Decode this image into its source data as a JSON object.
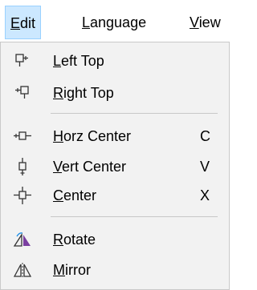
{
  "menubar": {
    "items": [
      {
        "mnemonic": "E",
        "rest": "dit"
      },
      {
        "mnemonic": "L",
        "rest": "anguage"
      },
      {
        "mnemonic": "V",
        "rest": "iew"
      }
    ]
  },
  "menu": {
    "items": [
      {
        "mnemonic": "L",
        "rest": "eft Top",
        "shortcut": "",
        "icon": "align-left-top-icon"
      },
      {
        "mnemonic": "R",
        "rest": "ight Top",
        "shortcut": "",
        "icon": "align-right-top-icon"
      },
      {
        "mnemonic": "H",
        "rest": "orz Center",
        "shortcut": "C",
        "icon": "horizontal-center-icon"
      },
      {
        "mnemonic": "V",
        "rest": "ert Center",
        "shortcut": "V",
        "icon": "vertical-center-icon"
      },
      {
        "mnemonic": "C",
        "rest": "enter",
        "shortcut": "X",
        "icon": "center-icon"
      },
      {
        "mnemonic": "R",
        "rest": "otate",
        "shortcut": "",
        "icon": "rotate-icon"
      },
      {
        "mnemonic": "M",
        "rest": "irror",
        "shortcut": "",
        "icon": "mirror-icon"
      }
    ]
  },
  "colors": {
    "menubar_active_bg": "#cce8ff",
    "menu_bg": "#f2f2f2",
    "icon_purple": "#7a3fa0",
    "accent_blue": "#1e8fe6"
  }
}
